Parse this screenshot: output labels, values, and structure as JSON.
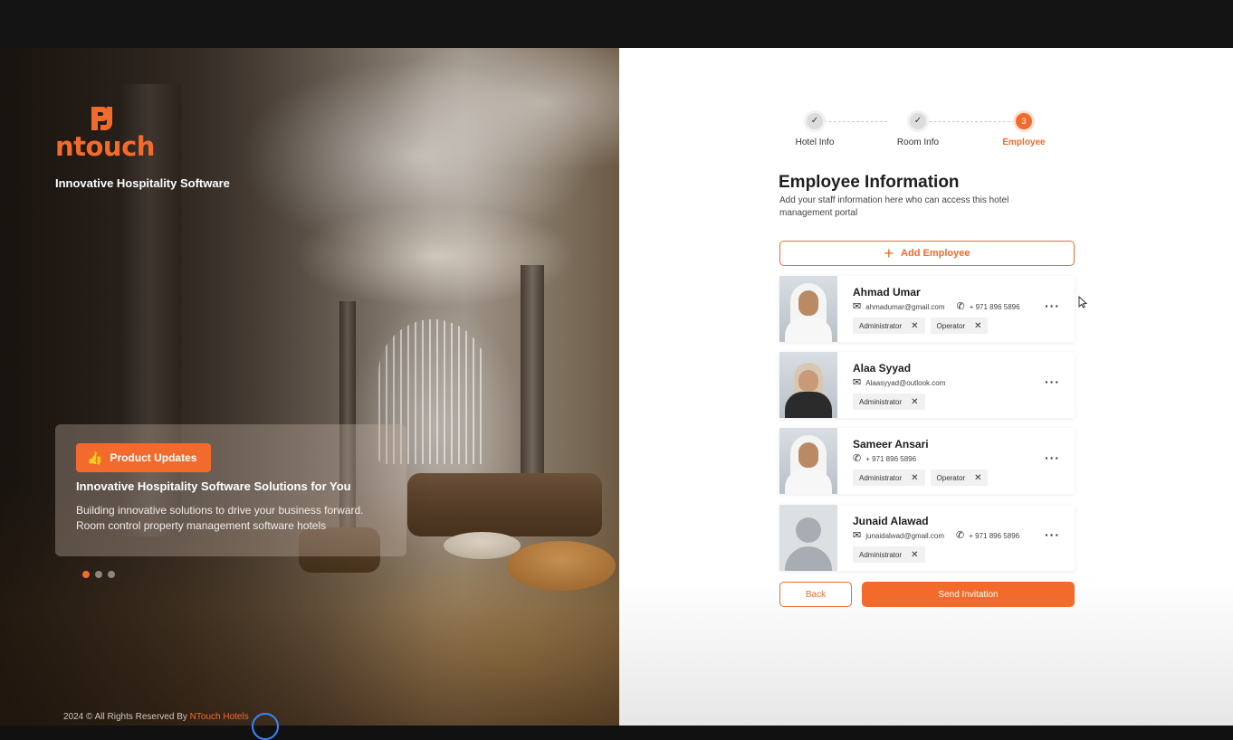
{
  "brand": {
    "logo_text": "ntouch",
    "tagline": "Innovative Hospitality Software",
    "accent_color": "#f26b2c"
  },
  "promo": {
    "badge_label": "Product Updates",
    "badge_icon": "thumbs-up-icon",
    "title": "Innovative Hospitality Software Solutions for You",
    "description": "Building innovative solutions to drive your business forward. Room control  property management software hotels",
    "slides": 3,
    "active_slide": 1
  },
  "footer": {
    "copyright": "2024 ©  All Rights Reserved By ",
    "brand_link": "NTouch Hotels"
  },
  "stepper": {
    "steps": [
      {
        "label": "Hotel Info",
        "state": "done",
        "marker": "✓"
      },
      {
        "label": "Room Info",
        "state": "done",
        "marker": "✓"
      },
      {
        "label": "Employee",
        "state": "current",
        "marker": "3"
      }
    ]
  },
  "form": {
    "title": "Employee Information",
    "description": "Add your staff information here who can access this hotel management portal",
    "add_button_label": "Add Employee",
    "back_label": "Back",
    "send_label": "Send Invitation"
  },
  "employees": [
    {
      "name": "Ahmad Umar",
      "email": "ahmadumar@gmail.com",
      "phone": "+ 971 896 5896",
      "roles": [
        "Administrator",
        "Operator"
      ],
      "photo": "man-ghutra"
    },
    {
      "name": "Alaa Syyad",
      "email": "Alaasyyad@outlook.com",
      "phone": "",
      "roles": [
        "Administrator"
      ],
      "photo": "woman-hijab"
    },
    {
      "name": "Sameer Ansari",
      "email": "",
      "phone": "+ 971 896 5896",
      "roles": [
        "Administrator",
        "Operator"
      ],
      "photo": "man-ghutra"
    },
    {
      "name": "Junaid Alawad",
      "email": "junaidalwad@gmail.com",
      "phone": "+ 971 896 5896",
      "roles": [
        "Administrator"
      ],
      "photo": "placeholder"
    }
  ],
  "icons": {
    "email": "✉",
    "phone": "✆",
    "remove": "✕",
    "more": "···",
    "plus": "+"
  }
}
